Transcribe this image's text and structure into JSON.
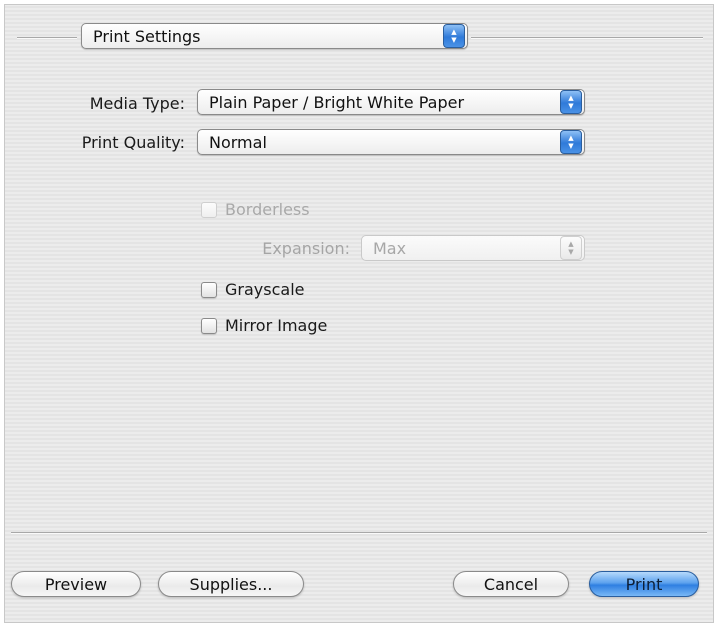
{
  "section_popup": {
    "value": "Print Settings"
  },
  "fields": {
    "media_type": {
      "label": "Media Type:",
      "value": "Plain Paper / Bright White Paper"
    },
    "print_quality": {
      "label": "Print Quality:",
      "value": "Normal"
    }
  },
  "borderless": {
    "label": "Borderless",
    "checked": false,
    "enabled": false
  },
  "expansion": {
    "label": "Expansion:",
    "value": "Max",
    "enabled": false
  },
  "grayscale": {
    "label": "Grayscale",
    "checked": false
  },
  "mirror_image": {
    "label": "Mirror Image",
    "checked": false
  },
  "buttons": {
    "preview": "Preview",
    "supplies": "Supplies...",
    "cancel": "Cancel",
    "print": "Print"
  },
  "colors": {
    "accent": "#2f7ad9",
    "disabled_text": "#a7a7a7"
  }
}
